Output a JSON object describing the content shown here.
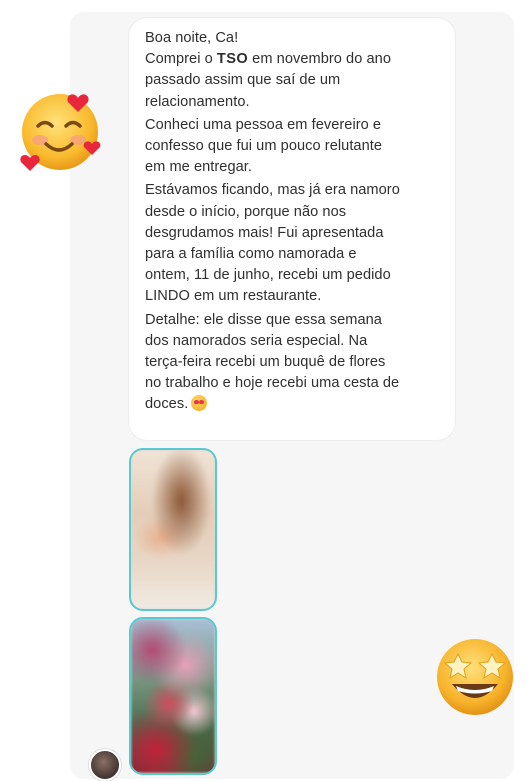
{
  "message": {
    "lines": [
      {
        "text": "Boa noite, Ca!"
      },
      {
        "pre": "Comprei o ",
        "tag": "TSO",
        "post": " em novembro do ano"
      },
      {
        "text": "passado assim que saí de um"
      },
      {
        "text": "relacionamento."
      },
      {
        "text": "Conheci uma pessoa em fevereiro e"
      },
      {
        "text": "confesso que fui um pouco relutante"
      },
      {
        "text": "em me entregar."
      },
      {
        "text": "Estávamos ficando, mas já era namoro"
      },
      {
        "text": "desde o início, porque não nos"
      },
      {
        "text": "desgrudamos mais! Fui apresentada"
      },
      {
        "text": "para a família como namorada e"
      },
      {
        "text": "ontem, 11 de junho, recebi um pedido"
      },
      {
        "text": "LINDO em um restaurante."
      },
      {
        "text": "Detalhe: ele disse que essa semana"
      },
      {
        "text": "dos namorados seria especial. Na"
      },
      {
        "text": "terça-feira recebi um buquê de flores"
      },
      {
        "text": "no trabalho e hoje recebi uma cesta de"
      },
      {
        "text": "doces."
      }
    ],
    "trailing_emoji": "heart-eyes-emoji"
  },
  "stories": [
    {
      "icon": "story-photo-woman-blurred",
      "ring_color": "#58c9cf"
    },
    {
      "icon": "story-photo-flowers-bouquet",
      "ring_color": "#58c9cf"
    }
  ],
  "stickers": {
    "left": "smiling-face-with-hearts",
    "right": "star-struck-face"
  },
  "colors": {
    "bubble_bg": "#ffffff",
    "panel_bg": "#f6f6f6",
    "text": "#2f2f2f",
    "story_ring": "#58c9cf"
  }
}
